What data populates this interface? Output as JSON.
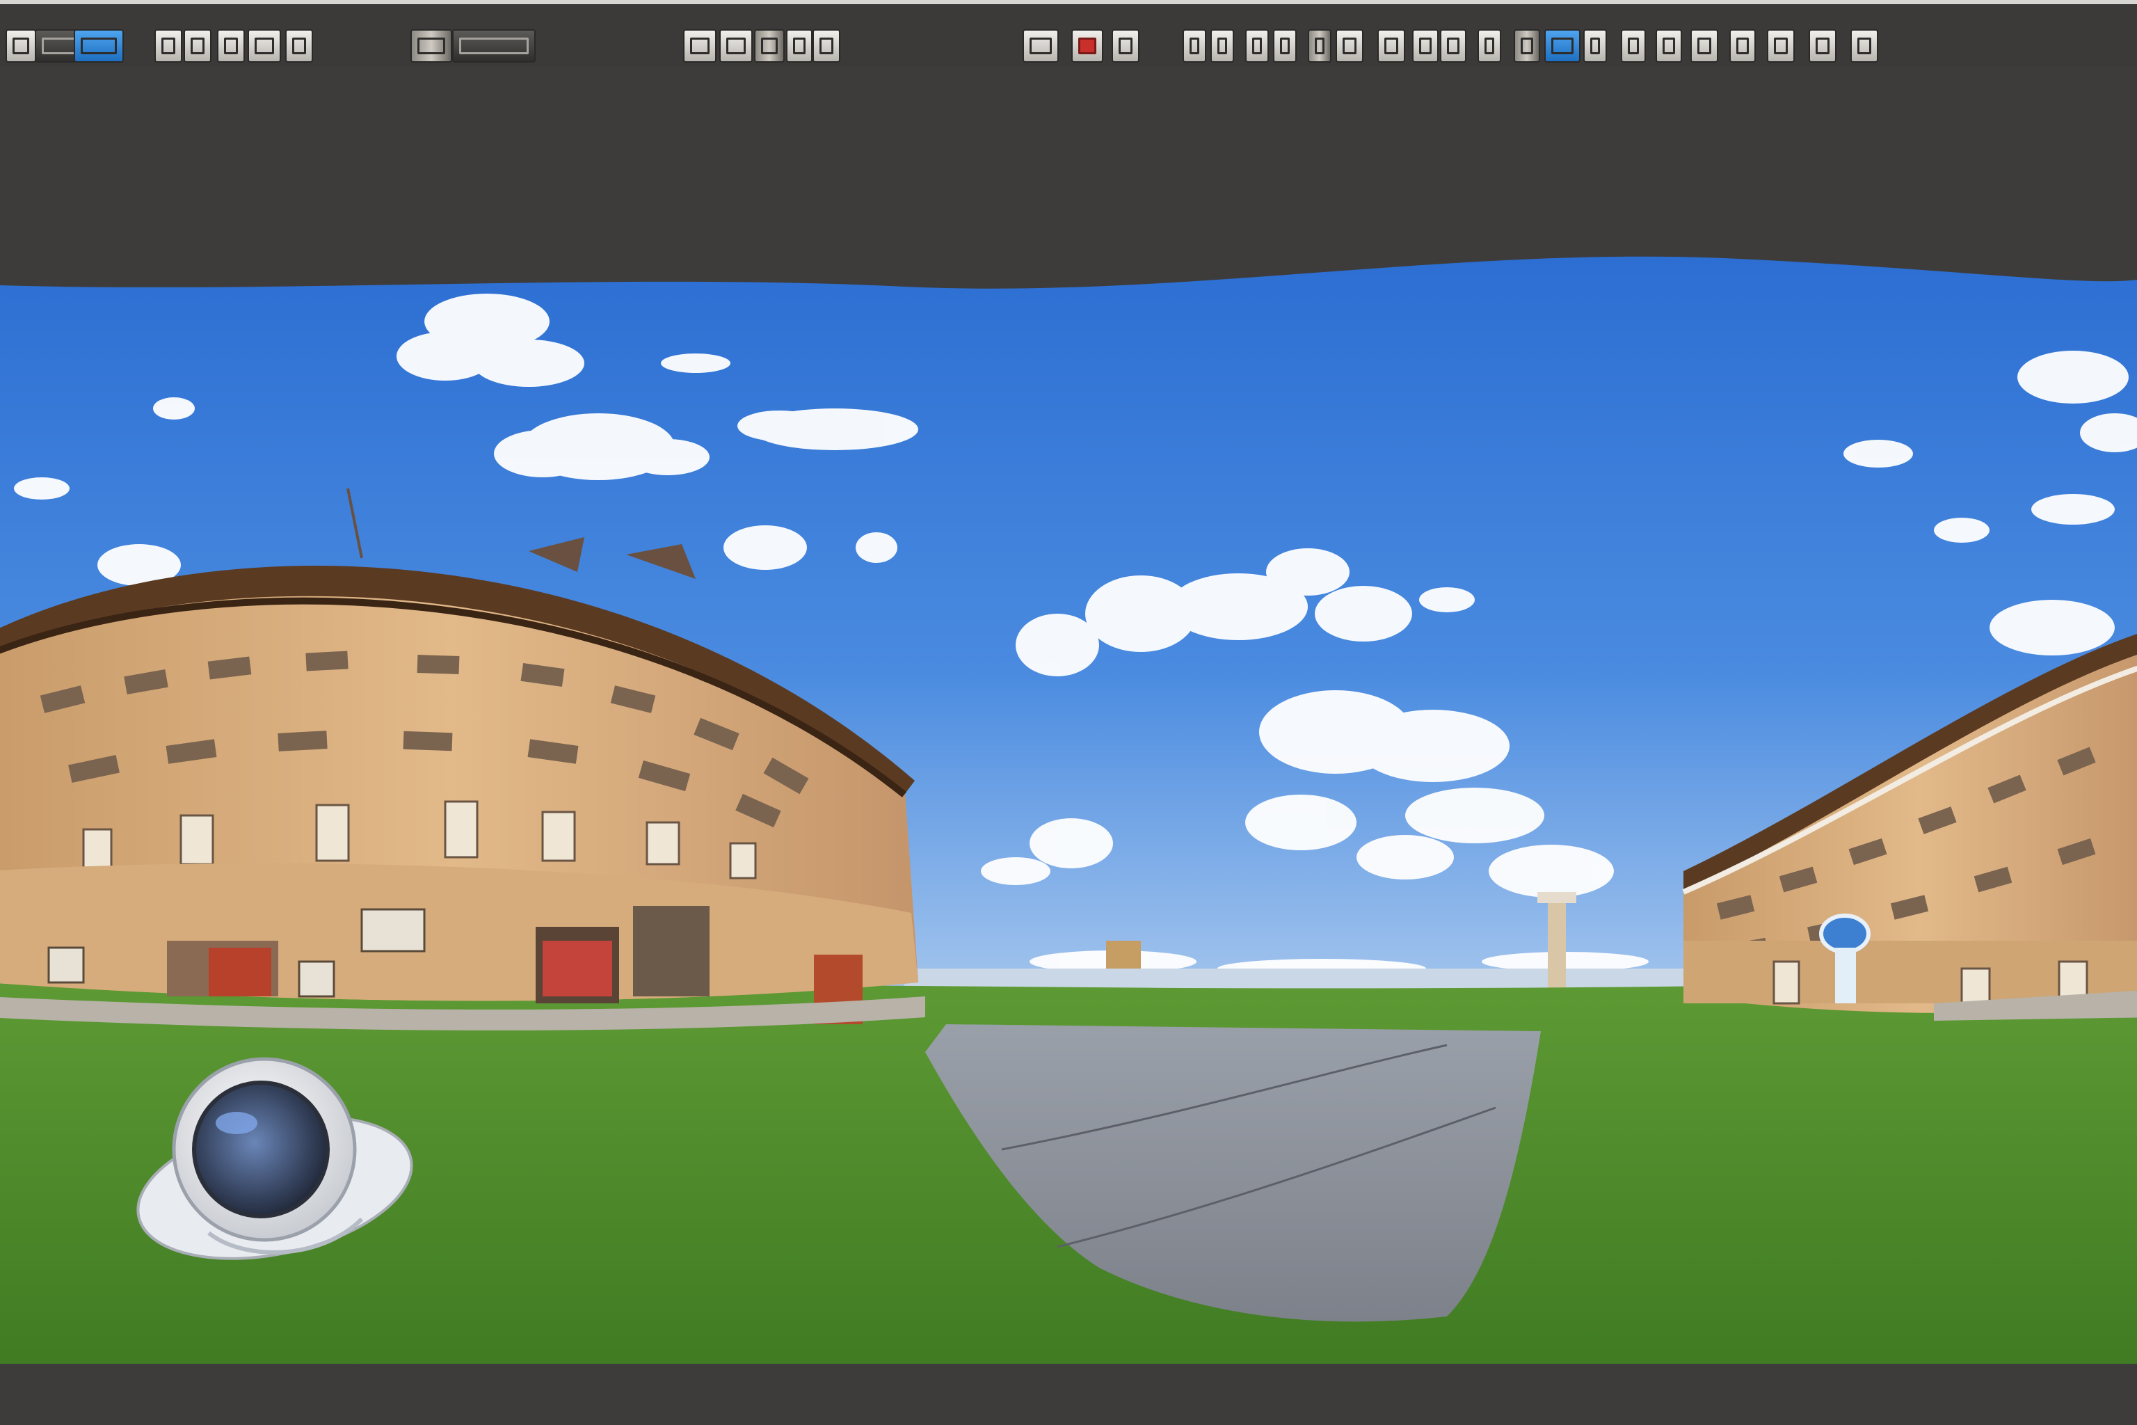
{
  "window": {
    "title": ""
  },
  "toolbar": {
    "buttons": [
      {
        "name": "toolbar-button-1",
        "style": "plain"
      },
      {
        "name": "toolbar-button-2",
        "style": "dark"
      },
      {
        "name": "toolbar-button-3",
        "style": "blue"
      },
      {
        "name": "toolbar-button-4",
        "style": "plain"
      },
      {
        "name": "toolbar-button-5",
        "style": "plain"
      },
      {
        "name": "toolbar-button-6",
        "style": "plain"
      },
      {
        "name": "toolbar-button-7",
        "style": "plain"
      },
      {
        "name": "toolbar-button-8",
        "style": "plain"
      },
      {
        "name": "toolbar-button-9",
        "style": "photo"
      },
      {
        "name": "toolbar-button-10",
        "style": "dark"
      },
      {
        "name": "toolbar-button-11",
        "style": "plain"
      },
      {
        "name": "toolbar-button-12",
        "style": "plain"
      },
      {
        "name": "toolbar-button-13",
        "style": "photo"
      },
      {
        "name": "toolbar-button-14",
        "style": "plain"
      },
      {
        "name": "toolbar-button-15",
        "style": "plain"
      },
      {
        "name": "toolbar-button-16",
        "style": "plain"
      },
      {
        "name": "toolbar-button-17",
        "style": "red"
      },
      {
        "name": "toolbar-button-18",
        "style": "plain"
      },
      {
        "name": "toolbar-button-19",
        "style": "plain"
      },
      {
        "name": "toolbar-button-20",
        "style": "plain"
      },
      {
        "name": "toolbar-button-21",
        "style": "plain"
      },
      {
        "name": "toolbar-button-22",
        "style": "plain"
      },
      {
        "name": "toolbar-button-23",
        "style": "photo"
      },
      {
        "name": "toolbar-button-24",
        "style": "plain"
      },
      {
        "name": "toolbar-button-25",
        "style": "plain"
      },
      {
        "name": "toolbar-button-26",
        "style": "plain"
      },
      {
        "name": "toolbar-button-27",
        "style": "plain"
      },
      {
        "name": "toolbar-button-28",
        "style": "plain"
      },
      {
        "name": "toolbar-button-29",
        "style": "photo"
      },
      {
        "name": "toolbar-button-30",
        "style": "blue"
      },
      {
        "name": "toolbar-button-31",
        "style": "plain"
      },
      {
        "name": "toolbar-button-32",
        "style": "plain"
      },
      {
        "name": "toolbar-button-33",
        "style": "plain"
      },
      {
        "name": "toolbar-button-34",
        "style": "plain"
      },
      {
        "name": "toolbar-button-35",
        "style": "plain"
      },
      {
        "name": "toolbar-button-36",
        "style": "plain"
      },
      {
        "name": "toolbar-button-37",
        "style": "plain"
      },
      {
        "name": "toolbar-button-38",
        "style": "plain"
      }
    ]
  },
  "colors": {
    "chrome": "#3d3c3b",
    "sky_top": "#2f6fd0",
    "sky_bottom": "#9fc2ea",
    "grass": "#4f8a2c",
    "building": "#d8ad7c",
    "roof": "#5a3b24",
    "path": "#8d9098"
  },
  "scene": {
    "kind": "equirectangular-panorama",
    "icons": [
      "camera-dome-icon"
    ]
  }
}
